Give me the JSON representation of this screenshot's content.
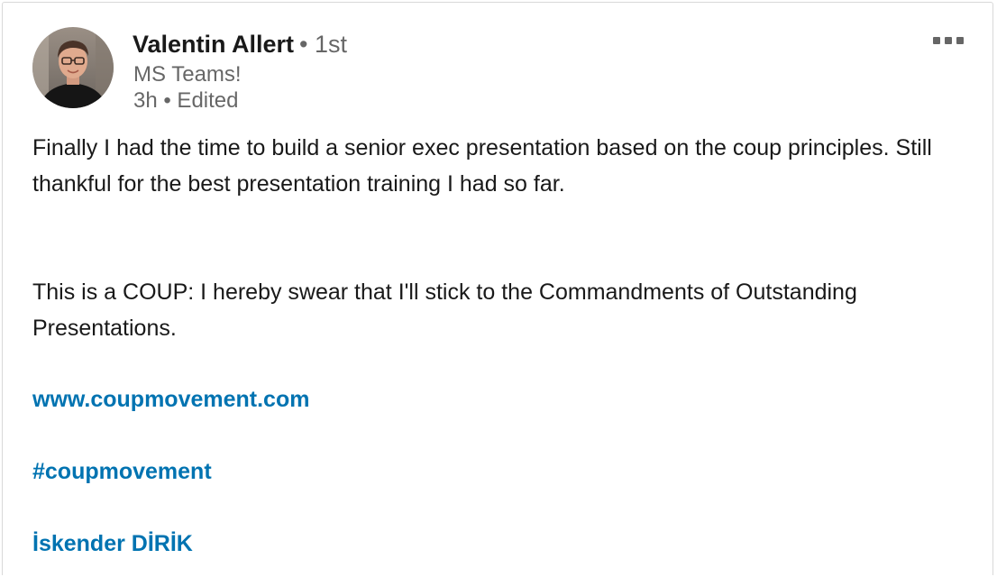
{
  "post": {
    "actor": {
      "name": "Valentin Allert",
      "degree": "• 1st",
      "headline": "MS Teams!",
      "meta": "3h • Edited"
    },
    "icons": {
      "more": "more-horizontal-icon"
    },
    "paragraph_1": "Finally I had the time to build a senior exec presentation based on the coup principles. Still thankful for the best presentation training I had so far.",
    "paragraph_2": "This is a COUP: I hereby swear that I'll stick to the Commandments of Outstanding Presentations.",
    "link_url": "www.coupmovement.com",
    "hashtag": "#coupmovement",
    "mention": "İskender DİRİK",
    "colors": {
      "link": "#0073b1",
      "text": "#1a1a1a",
      "muted": "#666666"
    }
  }
}
